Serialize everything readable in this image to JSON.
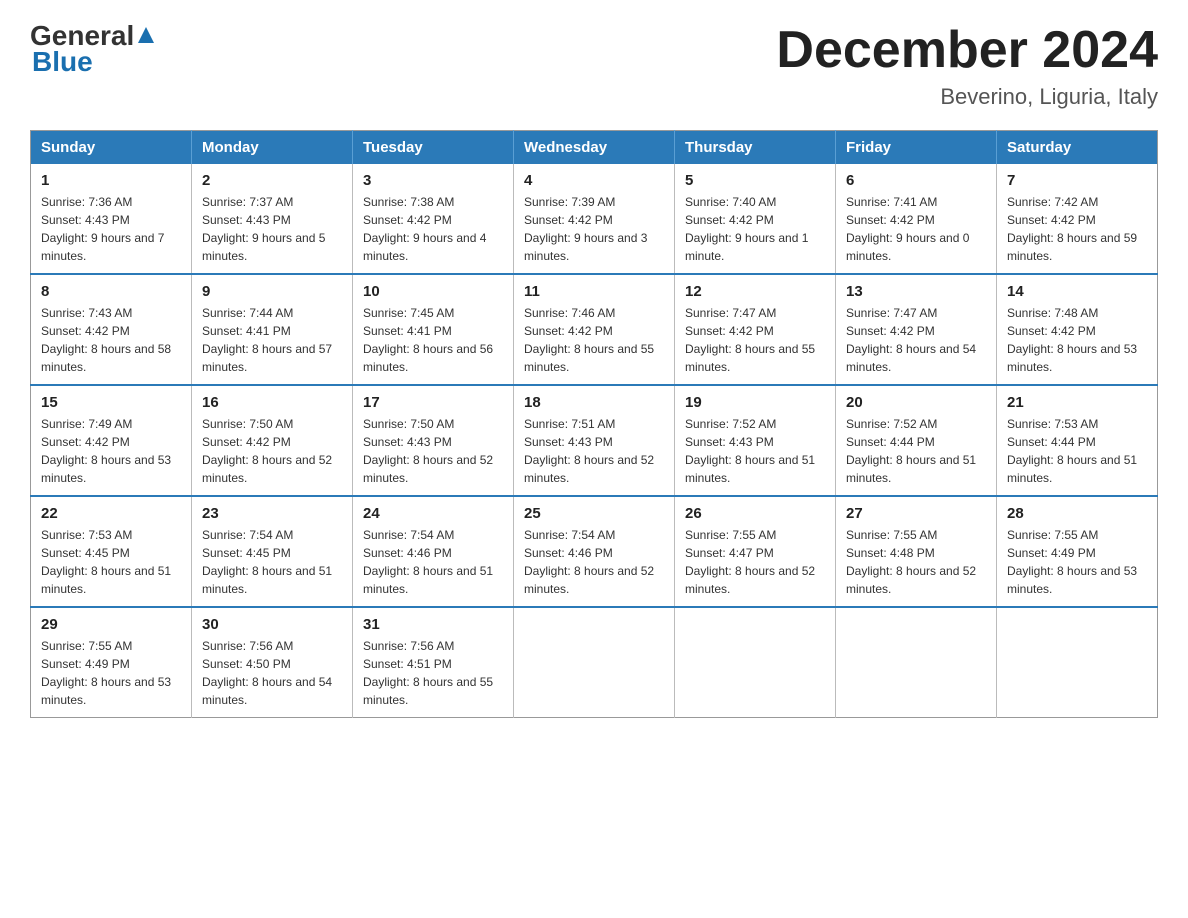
{
  "header": {
    "logo": {
      "general": "General",
      "blue": "Blue"
    },
    "title": "December 2024",
    "location": "Beverino, Liguria, Italy"
  },
  "weekdays": [
    "Sunday",
    "Monday",
    "Tuesday",
    "Wednesday",
    "Thursday",
    "Friday",
    "Saturday"
  ],
  "weeks": [
    [
      {
        "day": "1",
        "sunrise": "7:36 AM",
        "sunset": "4:43 PM",
        "daylight": "9 hours and 7 minutes."
      },
      {
        "day": "2",
        "sunrise": "7:37 AM",
        "sunset": "4:43 PM",
        "daylight": "9 hours and 5 minutes."
      },
      {
        "day": "3",
        "sunrise": "7:38 AM",
        "sunset": "4:42 PM",
        "daylight": "9 hours and 4 minutes."
      },
      {
        "day": "4",
        "sunrise": "7:39 AM",
        "sunset": "4:42 PM",
        "daylight": "9 hours and 3 minutes."
      },
      {
        "day": "5",
        "sunrise": "7:40 AM",
        "sunset": "4:42 PM",
        "daylight": "9 hours and 1 minute."
      },
      {
        "day": "6",
        "sunrise": "7:41 AM",
        "sunset": "4:42 PM",
        "daylight": "9 hours and 0 minutes."
      },
      {
        "day": "7",
        "sunrise": "7:42 AM",
        "sunset": "4:42 PM",
        "daylight": "8 hours and 59 minutes."
      }
    ],
    [
      {
        "day": "8",
        "sunrise": "7:43 AM",
        "sunset": "4:42 PM",
        "daylight": "8 hours and 58 minutes."
      },
      {
        "day": "9",
        "sunrise": "7:44 AM",
        "sunset": "4:41 PM",
        "daylight": "8 hours and 57 minutes."
      },
      {
        "day": "10",
        "sunrise": "7:45 AM",
        "sunset": "4:41 PM",
        "daylight": "8 hours and 56 minutes."
      },
      {
        "day": "11",
        "sunrise": "7:46 AM",
        "sunset": "4:42 PM",
        "daylight": "8 hours and 55 minutes."
      },
      {
        "day": "12",
        "sunrise": "7:47 AM",
        "sunset": "4:42 PM",
        "daylight": "8 hours and 55 minutes."
      },
      {
        "day": "13",
        "sunrise": "7:47 AM",
        "sunset": "4:42 PM",
        "daylight": "8 hours and 54 minutes."
      },
      {
        "day": "14",
        "sunrise": "7:48 AM",
        "sunset": "4:42 PM",
        "daylight": "8 hours and 53 minutes."
      }
    ],
    [
      {
        "day": "15",
        "sunrise": "7:49 AM",
        "sunset": "4:42 PM",
        "daylight": "8 hours and 53 minutes."
      },
      {
        "day": "16",
        "sunrise": "7:50 AM",
        "sunset": "4:42 PM",
        "daylight": "8 hours and 52 minutes."
      },
      {
        "day": "17",
        "sunrise": "7:50 AM",
        "sunset": "4:43 PM",
        "daylight": "8 hours and 52 minutes."
      },
      {
        "day": "18",
        "sunrise": "7:51 AM",
        "sunset": "4:43 PM",
        "daylight": "8 hours and 52 minutes."
      },
      {
        "day": "19",
        "sunrise": "7:52 AM",
        "sunset": "4:43 PM",
        "daylight": "8 hours and 51 minutes."
      },
      {
        "day": "20",
        "sunrise": "7:52 AM",
        "sunset": "4:44 PM",
        "daylight": "8 hours and 51 minutes."
      },
      {
        "day": "21",
        "sunrise": "7:53 AM",
        "sunset": "4:44 PM",
        "daylight": "8 hours and 51 minutes."
      }
    ],
    [
      {
        "day": "22",
        "sunrise": "7:53 AM",
        "sunset": "4:45 PM",
        "daylight": "8 hours and 51 minutes."
      },
      {
        "day": "23",
        "sunrise": "7:54 AM",
        "sunset": "4:45 PM",
        "daylight": "8 hours and 51 minutes."
      },
      {
        "day": "24",
        "sunrise": "7:54 AM",
        "sunset": "4:46 PM",
        "daylight": "8 hours and 51 minutes."
      },
      {
        "day": "25",
        "sunrise": "7:54 AM",
        "sunset": "4:46 PM",
        "daylight": "8 hours and 52 minutes."
      },
      {
        "day": "26",
        "sunrise": "7:55 AM",
        "sunset": "4:47 PM",
        "daylight": "8 hours and 52 minutes."
      },
      {
        "day": "27",
        "sunrise": "7:55 AM",
        "sunset": "4:48 PM",
        "daylight": "8 hours and 52 minutes."
      },
      {
        "day": "28",
        "sunrise": "7:55 AM",
        "sunset": "4:49 PM",
        "daylight": "8 hours and 53 minutes."
      }
    ],
    [
      {
        "day": "29",
        "sunrise": "7:55 AM",
        "sunset": "4:49 PM",
        "daylight": "8 hours and 53 minutes."
      },
      {
        "day": "30",
        "sunrise": "7:56 AM",
        "sunset": "4:50 PM",
        "daylight": "8 hours and 54 minutes."
      },
      {
        "day": "31",
        "sunrise": "7:56 AM",
        "sunset": "4:51 PM",
        "daylight": "8 hours and 55 minutes."
      },
      null,
      null,
      null,
      null
    ]
  ]
}
